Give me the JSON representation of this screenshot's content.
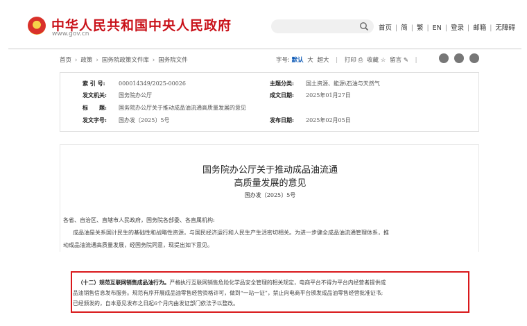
{
  "header": {
    "site_title": "中华人民共和国中央人民政府",
    "site_url": "www.gov.cn",
    "links": [
      "首页",
      "简",
      "繁",
      "EN",
      "登录",
      "邮箱",
      "无障碍"
    ]
  },
  "breadcrumb": [
    "首页",
    "政策",
    "国务院政策文件库",
    "国务院文件"
  ],
  "toolbar": {
    "font_label": "字号:",
    "font_default": "默认",
    "font_big": "大",
    "font_bigger": "超大",
    "print": "打印",
    "collect": "收藏",
    "comment": "留言"
  },
  "meta": {
    "index_key": "索 引 号:",
    "index_val": "000014349/2025-00026",
    "category_key": "主题分类:",
    "category_val": "国土资源、能源\\石油与天然气",
    "issuer_key": "发文机关:",
    "issuer_val": "国务院办公厅",
    "created_key": "成文日期:",
    "created_val": "2025年01月27日",
    "title_key": "标　　题:",
    "title_val": "国务院办公厅关于推动成品油流通高质量发展的意见",
    "docno_key": "发文字号:",
    "docno_val": "国办发〔2025〕5号",
    "published_key": "发布日期:",
    "published_val": "2025年02月05日"
  },
  "document": {
    "title_line1": "国务院办公厅关于推动成品油流通",
    "title_line2": "高质量发展的意见",
    "doc_number": "国办发〔2025〕5号",
    "salutation": "各省、自治区、直辖市人民政府，国务院各部委、各直属机构:",
    "intro_line1": "成品油是关系国计民生的基础性和战略性资源，与国民经济运行和人民生产生活密切相关。为进一步健全成品油流通管理体系，推",
    "intro_line2": "动成品油流通高质量发展，经国务院同意，现提出如下意见。"
  },
  "highlight": {
    "heading": "（十二）规范互联网销售成品油行为。",
    "line1_rest": "严格执行互联网销售危险化学品安全管理的相关规定，电商平台不得为平台内经营者提供成",
    "line2": "品油销售信息发布服务。规范有序开展成品油零售经营资格许可，做到“一站一证”，禁止向电商平台颁发成品油零售经营批准证书;",
    "line3": "已经颁发的，自本意见发布之日起6个月内由发证部门依法予以整改。"
  },
  "colors": {
    "brand_red": "#c9121a",
    "highlight_border": "#d9181b",
    "active_blue": "#0b58b5"
  },
  "icons": [
    "national-emblem-icon",
    "search-icon",
    "print-icon",
    "star-icon",
    "pencil-icon",
    "weibo-icon",
    "wechat-icon",
    "app-icon"
  ]
}
